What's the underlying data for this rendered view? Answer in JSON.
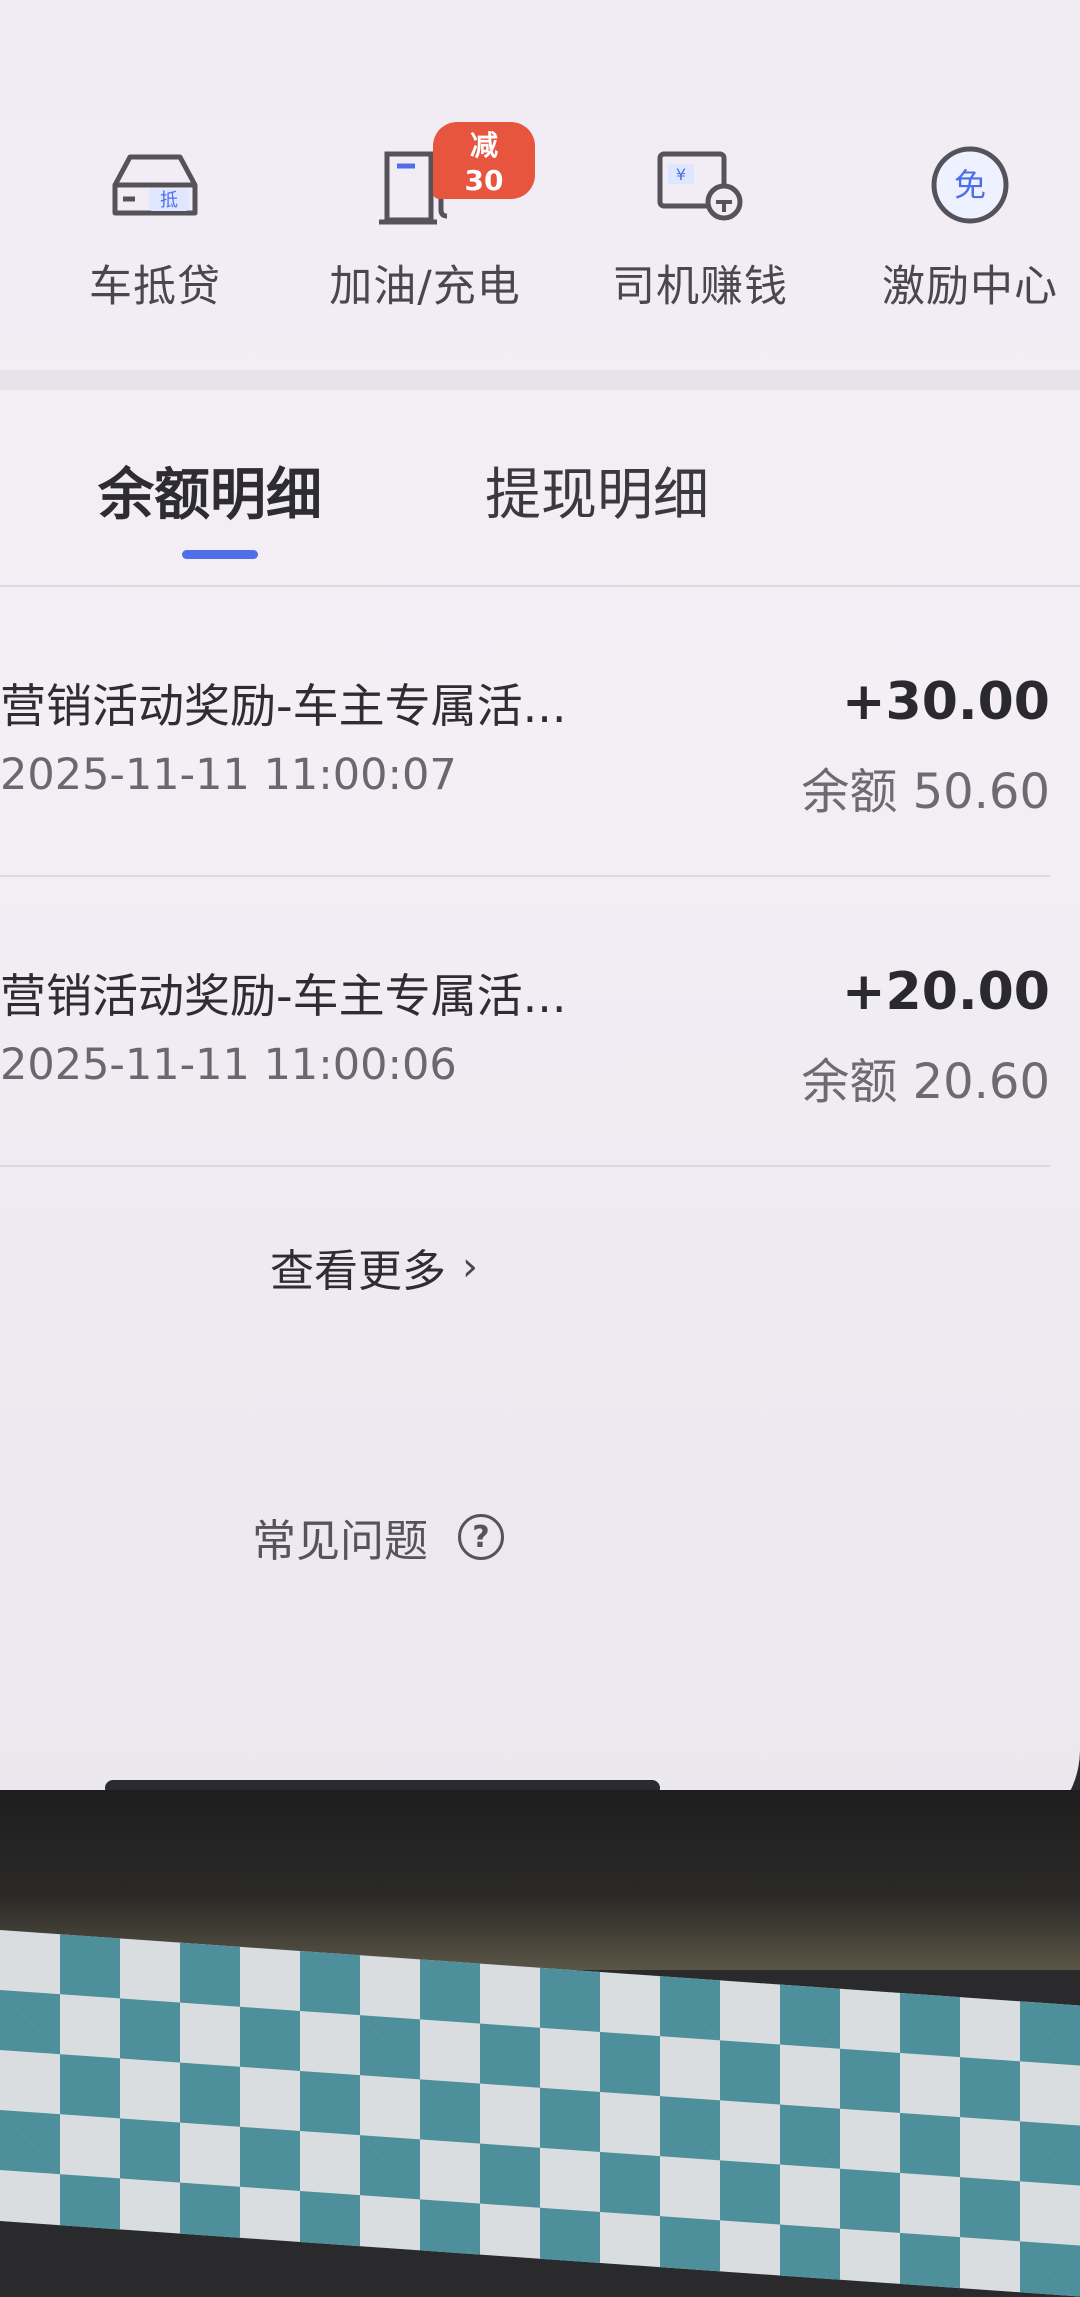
{
  "services": [
    {
      "label": "车抵贷",
      "icon": "car-loan-icon",
      "icon_text": "抵"
    },
    {
      "label": "加油/充电",
      "icon": "fuel-pump-icon",
      "badge": "减30"
    },
    {
      "label": "司机赚钱",
      "icon": "driver-earn-icon",
      "icon_text": "¥"
    },
    {
      "label": "激励中心",
      "icon": "incentive-icon",
      "icon_text": "免"
    }
  ],
  "tabs": [
    {
      "label": "余额明细",
      "active": true
    },
    {
      "label": "提现明细",
      "active": false
    }
  ],
  "records": [
    {
      "title": "营销活动奖励-车主专属活...",
      "time": "2025-11-11 11:00:07",
      "amount": "+30.00",
      "balance": "余额 50.60"
    },
    {
      "title": "营销活动奖励-车主专属活...",
      "time": "2025-11-11 11:00:06",
      "amount": "+20.00",
      "balance": "余额 20.60"
    }
  ],
  "more_label": "查看更多",
  "faq_label": "常见问题",
  "colors": {
    "accent": "#4f6fe8",
    "badge": "#e8553f"
  }
}
